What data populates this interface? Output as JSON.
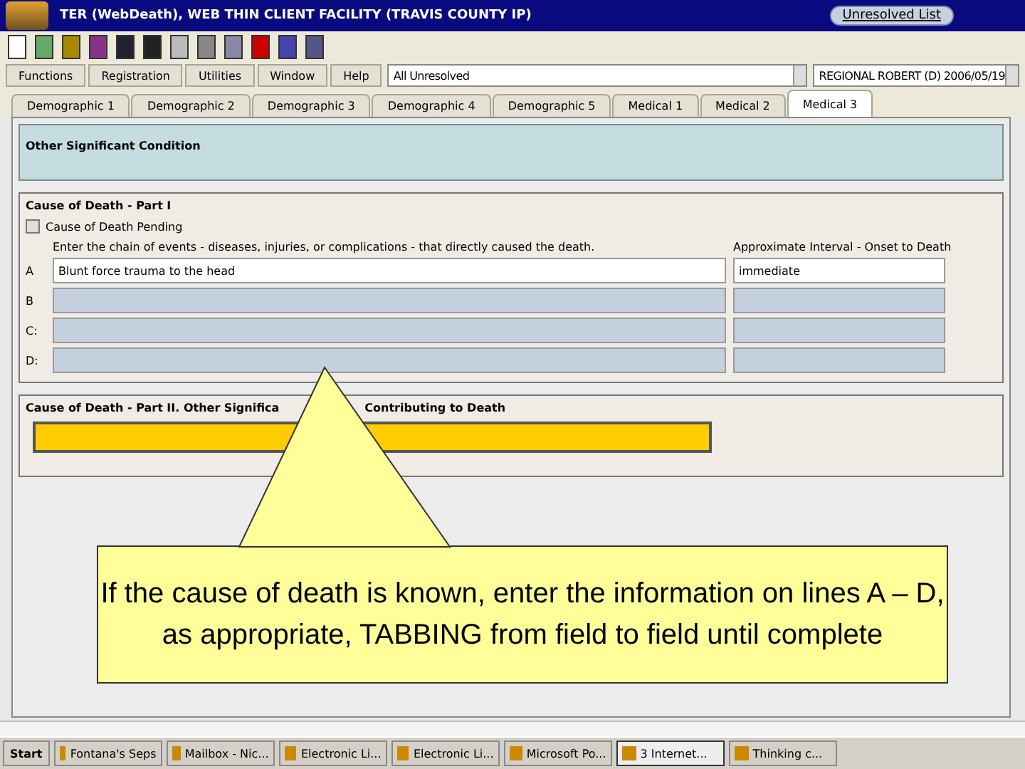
{
  "window": {
    "title": "TER (WebDeath), WEB THIN CLIENT FACILITY (TRAVIS COUNTY IP)",
    "title_button": "Unresolved List"
  },
  "menu": [
    "Functions",
    "Registration",
    "Utilities",
    "Window",
    "Help"
  ],
  "case_select": {
    "value": "All Unresolved"
  },
  "record_select": {
    "value": "REGIONAL ROBERT (D) 2006/05/19"
  },
  "tabs": [
    {
      "label": "Demographic 1",
      "selected": false
    },
    {
      "label": "Demographic 2",
      "selected": false
    },
    {
      "label": "Demographic 3",
      "selected": false
    },
    {
      "label": "Demographic 4",
      "selected": false
    },
    {
      "label": "Demographic 5",
      "selected": false
    },
    {
      "label": "Medical 1",
      "selected": false
    },
    {
      "label": "Medical 2",
      "selected": false
    },
    {
      "label": "Medical 3",
      "selected": true
    }
  ],
  "other_condition": {
    "heading": "Other Significant Condition"
  },
  "part1": {
    "heading": "Cause of Death - Part I",
    "pending": {
      "label": "Cause of Death Pending",
      "checked": false
    },
    "instruction": "Enter the chain of events - diseases, injuries, or complications - that directly caused the death.",
    "interval_heading": "Approximate Interval - Onset to Death",
    "rows": [
      {
        "label": "A",
        "value": "Blunt force trauma to the head",
        "interval": "immediate",
        "disabled": false
      },
      {
        "label": "B",
        "disabled": true
      },
      {
        "label": "C:",
        "disabled": true
      },
      {
        "label": "D:",
        "disabled": true
      }
    ]
  },
  "part2": {
    "heading_left": "Cause of Death - Part II. Other Significa",
    "heading_right": "Contributing to Death"
  },
  "callout": {
    "text": "If the cause of death is known, enter the information on lines A – D, as appropriate, TABBING from field to field until complete"
  },
  "taskbar": {
    "start": "Start",
    "items": [
      {
        "label": "Fontana's Seps",
        "selected": false
      },
      {
        "label": "Mailbox - Nic...",
        "selected": false
      },
      {
        "label": "Electronic Li...",
        "selected": false
      },
      {
        "label": "Electronic Li...",
        "selected": false
      },
      {
        "label": "Microsoft Po...",
        "selected": false
      },
      {
        "label": "3 Internet...",
        "selected": true
      },
      {
        "label": "Thinking c...",
        "selected": false
      }
    ]
  }
}
